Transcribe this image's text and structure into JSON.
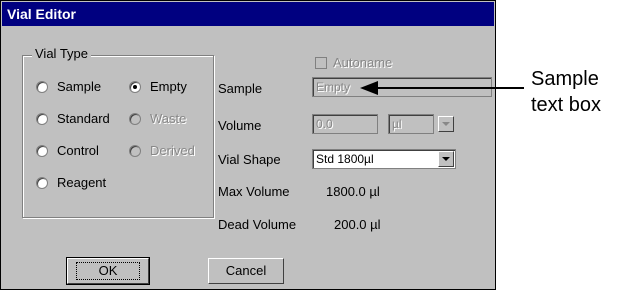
{
  "window": {
    "title": "Vial Editor"
  },
  "vial_type": {
    "label": "Vial Type",
    "options": [
      {
        "label": "Sample",
        "checked": false,
        "disabled": false
      },
      {
        "label": "Empty",
        "checked": true,
        "disabled": false
      },
      {
        "label": "Standard",
        "checked": false,
        "disabled": false
      },
      {
        "label": "Waste",
        "checked": false,
        "disabled": true
      },
      {
        "label": "Control",
        "checked": false,
        "disabled": false
      },
      {
        "label": "Derived",
        "checked": false,
        "disabled": true
      },
      {
        "label": "Reagent",
        "checked": false,
        "disabled": false
      }
    ]
  },
  "autoname": {
    "label": "Autoname",
    "checked": false,
    "disabled": true
  },
  "sample": {
    "label": "Sample",
    "value": "Empty"
  },
  "volume": {
    "label": "Volume",
    "value": "0.0",
    "unit": "µl"
  },
  "vial_shape": {
    "label": "Vial Shape",
    "value": "Std 1800µl"
  },
  "max_volume": {
    "label": "Max Volume",
    "value": "1800.0 µl"
  },
  "dead_volume": {
    "label": "Dead Volume",
    "value": "200.0 µl"
  },
  "buttons": {
    "ok": "OK",
    "cancel": "Cancel"
  },
  "callout": {
    "line1": "Sample",
    "line2": "text box"
  }
}
